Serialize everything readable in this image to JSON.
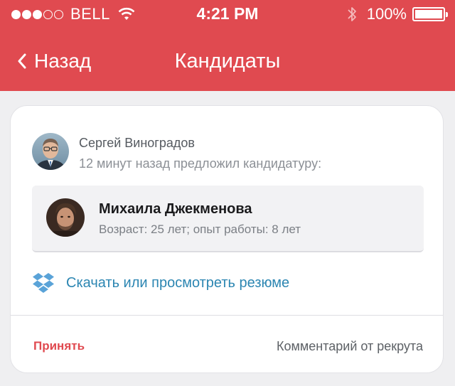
{
  "status_bar": {
    "carrier": "BELL",
    "time": "4:21 PM",
    "battery_percent": "100%",
    "signal_bars_filled": 3,
    "signal_bars_total": 5
  },
  "nav": {
    "back_label": "Назад",
    "title": "Кандидаты"
  },
  "card": {
    "author_name": "Сергей Виноградов",
    "author_action": "12 минут назад предложил кандидатуру:",
    "candidate_name": "Михаила Джекменова",
    "candidate_info": "Возраст: 25 лет; опыт работы: 8 лет",
    "resume_link": "Скачать или просмотреть резюме",
    "accept_label": "Принять",
    "comment_label": "Комментарий от рекрута"
  },
  "colors": {
    "accent": "#e04a50",
    "link": "#2c86b2"
  },
  "icons": {
    "wifi": "wifi-icon",
    "bluetooth": "bluetooth-icon",
    "battery": "battery-icon",
    "back": "chevron-left-icon",
    "resume": "dropbox-icon"
  }
}
